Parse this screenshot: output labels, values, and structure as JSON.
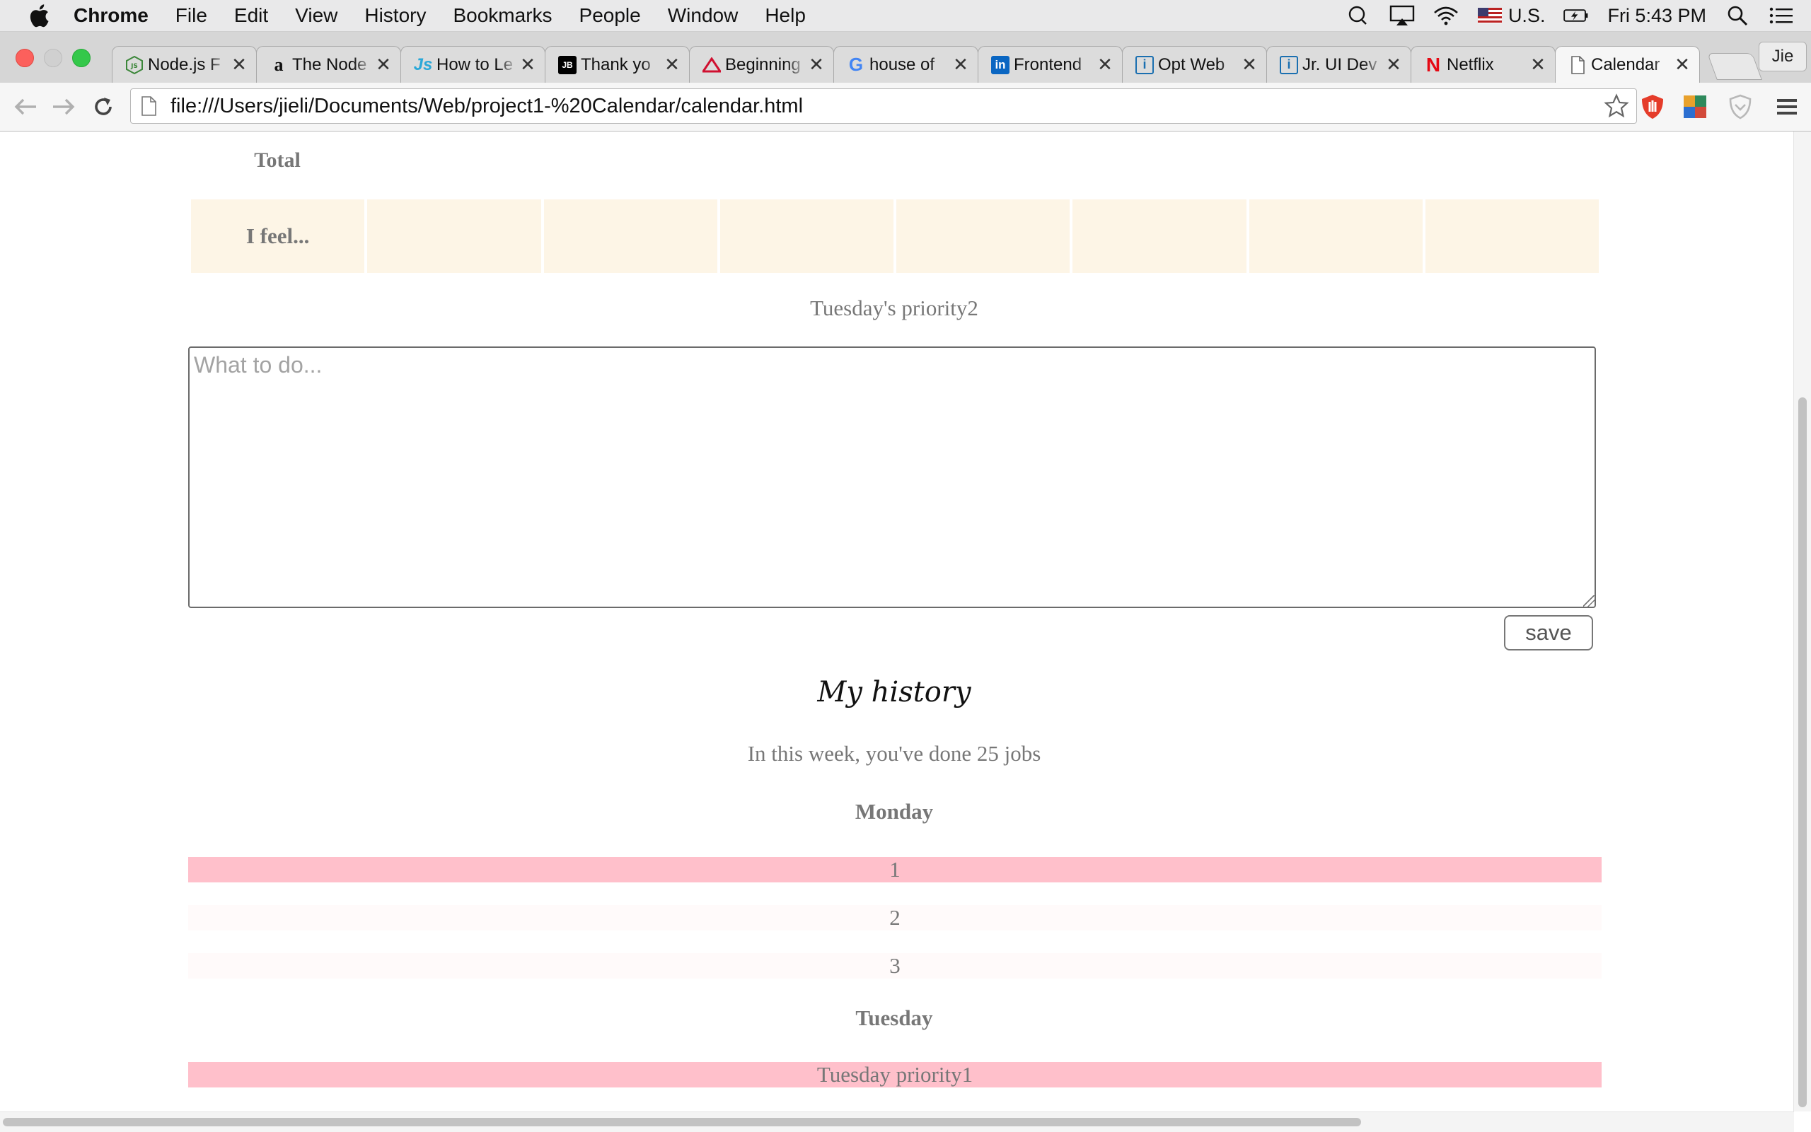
{
  "menubar": {
    "app_name": "Chrome",
    "items": [
      "File",
      "Edit",
      "View",
      "History",
      "Bookmarks",
      "People",
      "Window",
      "Help"
    ],
    "input_source": "U.S.",
    "clock": "Fri 5:43 PM"
  },
  "tabs": [
    {
      "title": "Node.js F",
      "favicon": "nodejs-icon",
      "color": "#3c873a",
      "active": false
    },
    {
      "title": "The Node",
      "favicon": "amazon-icon",
      "color": "#111111",
      "active": false
    },
    {
      "title": "How to Le",
      "favicon": "js-icon",
      "color": "#2aa8d8",
      "active": false
    },
    {
      "title": "Thank yo",
      "favicon": "jetbrains-icon",
      "color": "#000000",
      "active": false
    },
    {
      "title": "Beginning",
      "favicon": "triangle-icon",
      "color": "#d01030",
      "active": false
    },
    {
      "title": "house of",
      "favicon": "google-icon",
      "color": "#4285f4",
      "active": false
    },
    {
      "title": "Frontend",
      "favicon": "linkedin-icon",
      "color": "#0a66c2",
      "active": false
    },
    {
      "title": "Opt Web",
      "favicon": "info-icon",
      "color": "#1a6fb0",
      "active": false
    },
    {
      "title": "Jr. UI Dev",
      "favicon": "info-icon",
      "color": "#1a6fb0",
      "active": false
    },
    {
      "title": "Netflix",
      "favicon": "netflix-icon",
      "color": "#e50914",
      "active": false
    },
    {
      "title": "Calendar",
      "favicon": "page-icon",
      "color": "#666666",
      "active": true
    }
  ],
  "profile_name": "Jie",
  "toolbar": {
    "url": "file:///Users/jieli/Documents/Web/project1-%20Calendar/calendar.html"
  },
  "page": {
    "total_label": "Total",
    "feel_label": "I feel...",
    "feel_cells": [
      "",
      "",
      "",
      "",
      "",
      "",
      ""
    ],
    "priority_title": "Tuesday's priority2",
    "todo_placeholder": "What to do...",
    "todo_value": "",
    "save_label": "save",
    "history_title": "My history",
    "summary": "In this week, you've done 25 jobs",
    "days": [
      {
        "name": "Monday",
        "items": [
          "1",
          "2",
          "3"
        ]
      },
      {
        "name": "Tuesday",
        "items": [
          "Tuesday priority1"
        ]
      }
    ]
  },
  "colors": {
    "feel_cell_bg": "#fdf5e6",
    "first_item_bg": "#ffc0cb",
    "other_item_bg": "#fffafa",
    "text_gray": "#777777"
  }
}
